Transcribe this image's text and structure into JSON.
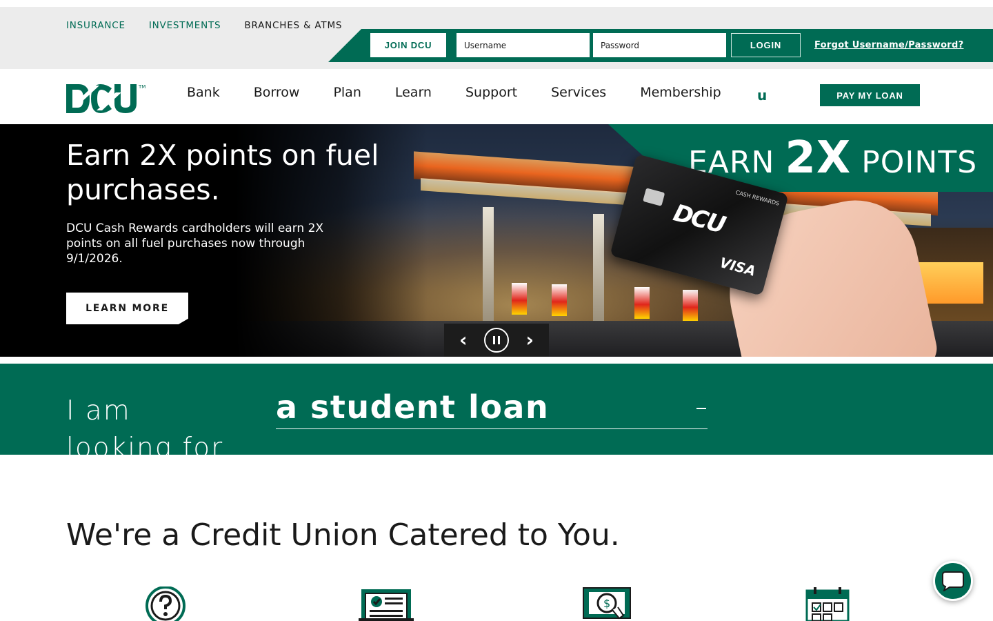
{
  "utility_nav": {
    "links": [
      "INSURANCE",
      "INVESTMENTS",
      "BRANCHES & ATMS"
    ]
  },
  "login": {
    "join_label": "JOIN DCU",
    "username_placeholder": "Username",
    "password_placeholder": "Password",
    "login_label": "LOGIN",
    "forgot_label": "Forgot Username/Password?"
  },
  "main_nav": {
    "logo_text": "DCU",
    "items": [
      "Bank",
      "Borrow",
      "Plan",
      "Learn",
      "Support",
      "Services",
      "Membership"
    ],
    "search_glyph": "u",
    "pay_label": "PAY MY LOAN"
  },
  "hero": {
    "title": "Earn 2X points on fuel purchases.",
    "body": "DCU Cash Rewards cardholders will earn 2X points on all fuel purchases now through 9/1/2026.",
    "cta_label": "LEARN MORE",
    "promo_prefix": "EARN",
    "promo_big": "2X",
    "promo_suffix": "POINTS",
    "card_logo": "DCU",
    "card_network": "VISA",
    "card_tag": "CASH REWARDS",
    "prev_glyph": "‹",
    "next_glyph": "›"
  },
  "looking_for": {
    "label": "I am looking for",
    "selected": "a student loan"
  },
  "section": {
    "title": "We're a Credit Union Catered to You."
  },
  "colors": {
    "brand_green": "#006b54",
    "top_bar": "#ececec"
  },
  "icons": [
    "question-icon",
    "document-check-icon",
    "money-cycle-icon",
    "calendar-check-icon",
    "chat-icon"
  ]
}
